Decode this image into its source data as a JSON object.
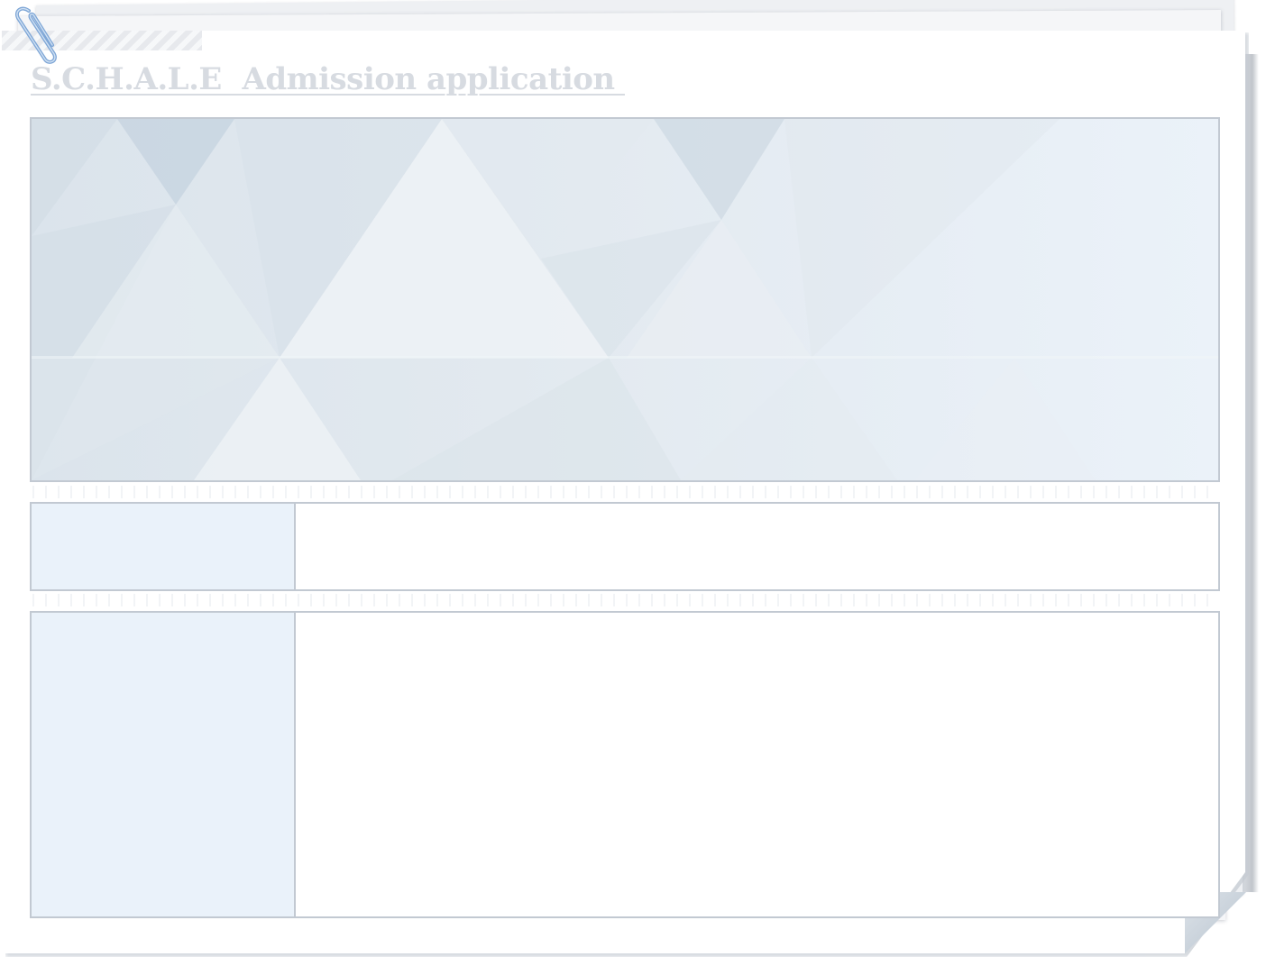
{
  "form": {
    "title": "S.C.H.A.L.E  Admission application ",
    "rows": [
      {
        "label": "",
        "value": ""
      },
      {
        "label": "",
        "value": ""
      }
    ]
  },
  "icons": {
    "paperclip": "paperclip-icon"
  },
  "colors": {
    "title": "#d7dbe1",
    "border": "#c2c9d2",
    "label_cell": "#eaf2fa",
    "banner": "#e2e9ef"
  }
}
